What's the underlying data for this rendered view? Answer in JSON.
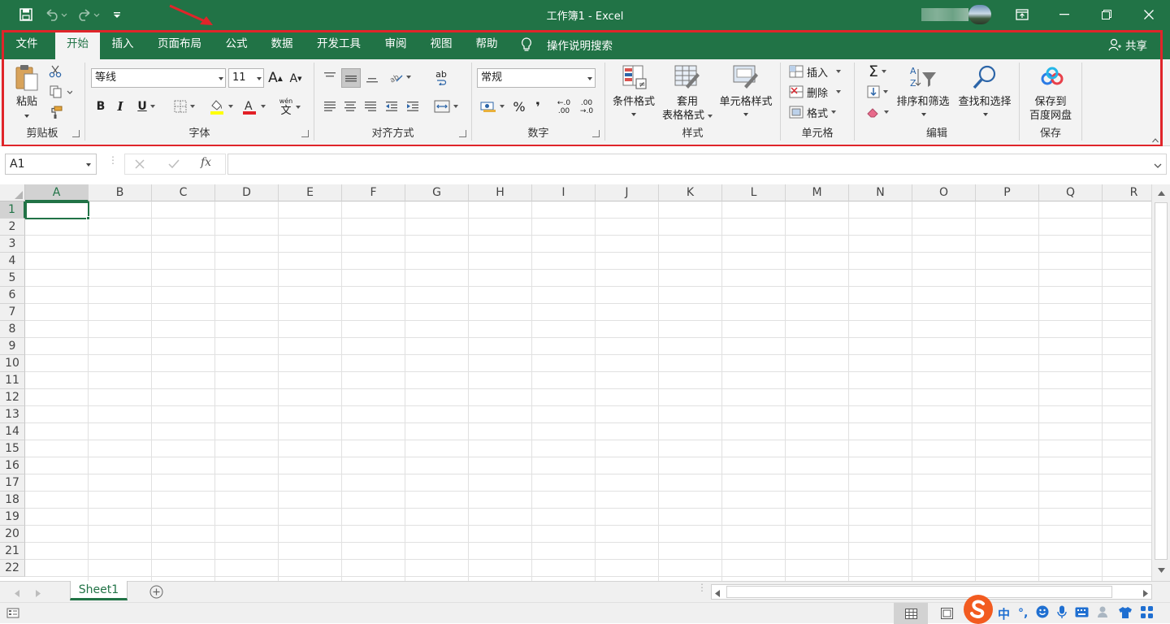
{
  "title_bar": {
    "title": "工作簿1  -  Excel",
    "account_icon": "user-avatar",
    "colors": {
      "brand": "#217346"
    }
  },
  "quick_access": {
    "save_icon": "save-icon",
    "undo_icon": "undo-icon",
    "redo_icon": "redo-icon",
    "customize_icon": "customize-qat-icon"
  },
  "window_controls": {
    "ribbon_display_icon": "ribbon-display-icon",
    "minimize_icon": "minimize-icon",
    "restore_icon": "restore-icon",
    "close_icon": "close-icon"
  },
  "menu": {
    "tabs": [
      "文件",
      "开始",
      "插入",
      "页面布局",
      "公式",
      "数据",
      "开发工具",
      "审阅",
      "视图",
      "帮助"
    ],
    "active_tab": "开始",
    "tell_me": "操作说明搜索",
    "share": "共享"
  },
  "ribbon": {
    "clipboard": {
      "label": "剪贴板",
      "paste": "粘贴"
    },
    "font": {
      "label": "字体",
      "font_name": "等线",
      "font_size": "11",
      "bold": "B",
      "italic": "I",
      "underline": "U",
      "grow": "A",
      "shrink": "A",
      "phonetic_top": "wén",
      "phonetic": "文",
      "font_color_bar": "#e21f26",
      "highlight_bar": "#ffff00"
    },
    "alignment": {
      "label": "对齐方式",
      "wrap_text": "ab"
    },
    "number": {
      "label": "数字",
      "format": "常规",
      "percent": "%",
      "comma": "❜",
      "increase_decimal_top": "←.0",
      "increase_decimal_bottom": ".00",
      "decrease_decimal_top": ".00",
      "decrease_decimal_bottom": "→.0"
    },
    "styles": {
      "label": "样式",
      "conditional": "条件格式",
      "table_format_1": "套用",
      "table_format_2": "表格格式",
      "cell_styles": "单元格样式"
    },
    "cells": {
      "label": "单元格",
      "insert": "插入",
      "delete": "删除",
      "format": "格式"
    },
    "editing": {
      "label": "编辑",
      "autosum": "Σ",
      "sort_filter": "排序和筛选",
      "find_select": "查找和选择"
    },
    "save": {
      "label": "保存",
      "save_line1": "保存到",
      "save_line2": "百度网盘"
    }
  },
  "formula_bar": {
    "name_box": "A1",
    "fx": "fx",
    "formula": ""
  },
  "grid": {
    "columns": [
      "A",
      "B",
      "C",
      "D",
      "E",
      "F",
      "G",
      "H",
      "I",
      "J",
      "K",
      "L",
      "M",
      "N",
      "O",
      "P",
      "Q",
      "R"
    ],
    "rows": [
      "1",
      "2",
      "3",
      "4",
      "5",
      "6",
      "7",
      "8",
      "9",
      "10",
      "11",
      "12",
      "13",
      "14",
      "15",
      "16",
      "17",
      "18",
      "19",
      "20",
      "21",
      "22"
    ],
    "selected_cell": "A1"
  },
  "sheets": {
    "tabs": [
      "Sheet1"
    ],
    "active": "Sheet1",
    "add_icon": "plus-circle-icon"
  },
  "status_bar": {
    "ime_label": "中",
    "view_normal_icon": "normal-view-icon",
    "view_page_icon": "page-layout-icon"
  }
}
